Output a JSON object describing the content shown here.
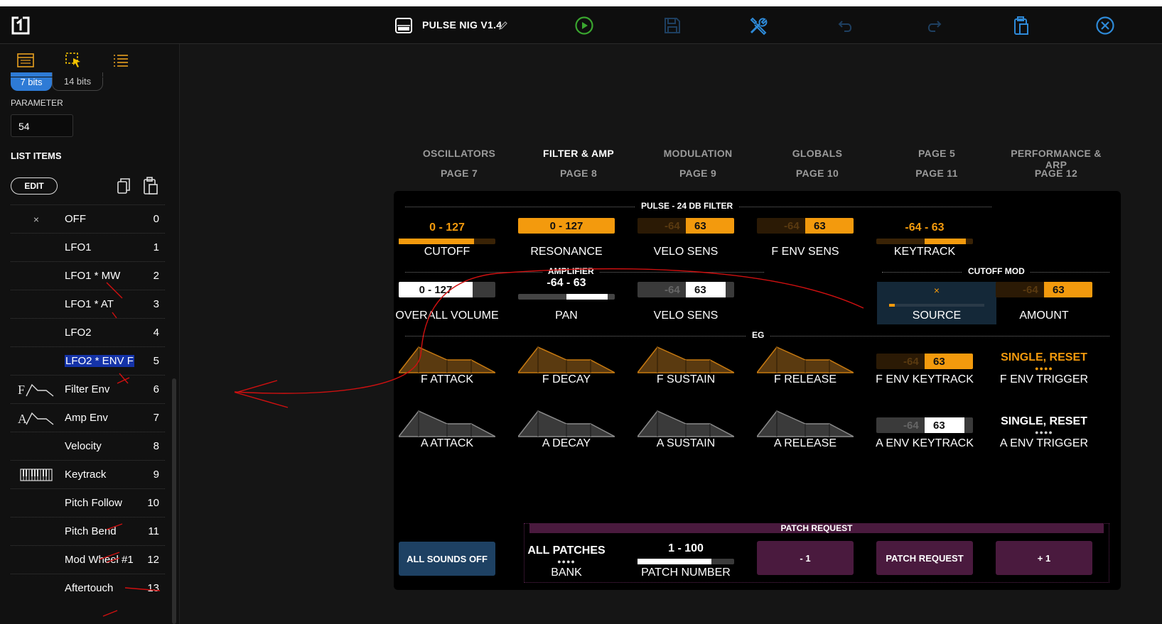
{
  "header": {
    "title": "PULSE NIG V1.4",
    "accent_play": "#3aa62f",
    "accent_blue": "#2e8ad8"
  },
  "sidebar": {
    "bits": [
      "7 bits",
      "14 bits"
    ],
    "parameter_label": "PARAMETER",
    "parameter_value": "54",
    "list_items_label": "LIST ITEMS",
    "edit_label": "EDIT",
    "items": [
      {
        "icon": "x-mark",
        "label": "OFF",
        "value": "0"
      },
      {
        "icon": "",
        "label": "LFO1",
        "value": "1"
      },
      {
        "icon": "",
        "label": "LFO1 * MW",
        "value": "2"
      },
      {
        "icon": "",
        "label": "LFO1 * AT",
        "value": "3"
      },
      {
        "icon": "",
        "label": "LFO2",
        "value": "4"
      },
      {
        "icon": "",
        "label": "LFO2 * ENV F",
        "value": "5"
      },
      {
        "icon": "filter-env-icon",
        "label": "Filter Env",
        "value": "6"
      },
      {
        "icon": "amp-env-icon",
        "label": "Amp Env",
        "value": "7"
      },
      {
        "icon": "",
        "label": "Velocity",
        "value": "8"
      },
      {
        "icon": "keyboard-icon",
        "label": "Keytrack",
        "value": "9"
      },
      {
        "icon": "",
        "label": "Pitch Follow",
        "value": "10"
      },
      {
        "icon": "",
        "label": "Pitch Bend",
        "value": "11"
      },
      {
        "icon": "",
        "label": "Mod Wheel #1",
        "value": "12"
      },
      {
        "icon": "",
        "label": "Aftertouch",
        "value": "13"
      }
    ]
  },
  "tabs": [
    {
      "name": "OSCILLATORS",
      "page": "PAGE 7"
    },
    {
      "name": "FILTER & AMP",
      "page": "PAGE 8"
    },
    {
      "name": "MODULATION",
      "page": "PAGE 9"
    },
    {
      "name": "GLOBALS",
      "page": "PAGE 10"
    },
    {
      "name": "PAGE 5",
      "page": "PAGE 11"
    },
    {
      "name": "PERFORMANCE & ARP",
      "page": "PAGE 12"
    }
  ],
  "sections": {
    "filter": "PULSE - 24 DB FILTER",
    "amplifier": "AMPLIFIER",
    "cutoff_mod": "CUTOFF MOD",
    "eg": "EG",
    "patch_request": "PATCH REQUEST"
  },
  "filter_controls": {
    "cutoff": {
      "label": "CUTOFF",
      "value": "0 - 127",
      "level": 0.78
    },
    "resonance": {
      "label": "RESONANCE",
      "value": "0 - 127"
    },
    "velo_sens": {
      "label": "VELO SENS",
      "lo": "-64",
      "hi": "63"
    },
    "f_env_sens": {
      "label": "F ENV SENS",
      "lo": "-64",
      "hi": "63"
    },
    "keytrack": {
      "label": "KEYTRACK",
      "value": "-64 - 63",
      "level": 0.95
    }
  },
  "amp_controls": {
    "overall_volume": {
      "label": "OVERALL VOLUME",
      "value": "0 - 127"
    },
    "pan": {
      "label": "PAN",
      "value": "-64 - 63",
      "level": 0.5
    },
    "velo_sens": {
      "label": "VELO SENS",
      "lo": "-64",
      "hi": "63"
    }
  },
  "cutoff_mod": {
    "source": {
      "label": "SOURCE",
      "value": "×"
    },
    "amount": {
      "label": "AMOUNT",
      "lo": "-64",
      "hi": "63"
    }
  },
  "eg": {
    "f_row": [
      "F ATTACK",
      "F DECAY",
      "F SUSTAIN",
      "F RELEASE"
    ],
    "a_row": [
      "A ATTACK",
      "A DECAY",
      "A SUSTAIN",
      "A RELEASE"
    ],
    "f_env_keytrack": {
      "label": "F ENV KEYTRACK",
      "lo": "-64",
      "hi": "63"
    },
    "a_env_keytrack": {
      "label": "A ENV KEYTRACK",
      "lo": "-64",
      "hi": "63"
    },
    "f_env_trigger": {
      "label": "F ENV TRIGGER",
      "value": "SINGLE, RESET"
    },
    "a_env_trigger": {
      "label": "A ENV TRIGGER",
      "value": "SINGLE, RESET"
    }
  },
  "bottom": {
    "all_sounds_off": "ALL SOUNDS OFF",
    "bank_value": "ALL PATCHES",
    "bank_label": "BANK",
    "patch_number_value": "1 - 100",
    "patch_number_label": "PATCH NUMBER",
    "minus": "- 1",
    "patch_request": "PATCH REQUEST",
    "plus": "+ 1"
  },
  "colors": {
    "orange": "#f39a0d",
    "orange_dark": "#3a2306",
    "purple": "#4a1a3e",
    "purple_bar": "#5a2350",
    "blue_btn": "#1e4163",
    "source_bg": "#142838"
  }
}
